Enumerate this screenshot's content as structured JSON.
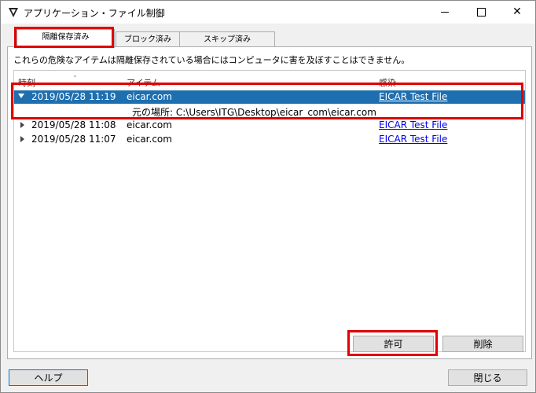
{
  "window": {
    "title": "アプリケーション・ファイル制御",
    "icon": "shield-v-icon",
    "controls": {
      "minimize": "minimize-icon",
      "maximize": "maximize-icon",
      "close": "✕"
    }
  },
  "tabs": [
    {
      "label": "隔離保存済み",
      "active": true
    },
    {
      "label": "ブロック済み",
      "active": false
    },
    {
      "label": "スキップ済み",
      "active": false
    }
  ],
  "warning_text": "これらの危険なアイテムは隔離保存されている場合にはコンピュータに害を及ぼすことはできません。",
  "list": {
    "columns": [
      "時刻",
      "アイテム",
      "感染"
    ],
    "rows": [
      {
        "time": "2019/05/28 11:19",
        "item": "eicar.com",
        "infection": "EICAR Test File",
        "expanded": true,
        "selected": true,
        "detail": "元の場所: C:\\Users\\ITG\\Desktop\\eicar_com\\eicar.com"
      },
      {
        "time": "2019/05/28 11:08",
        "item": "eicar.com",
        "infection": "EICAR Test File",
        "expanded": false,
        "selected": false
      },
      {
        "time": "2019/05/28 11:07",
        "item": "eicar.com",
        "infection": "EICAR Test File",
        "expanded": false,
        "selected": false
      }
    ]
  },
  "buttons": {
    "allow": "許可",
    "delete": "削除",
    "help": "ヘルプ",
    "close": "閉じる"
  },
  "colors": {
    "selection": "#1e6fb0",
    "highlight": "#e00000",
    "link": "#0000ee"
  }
}
